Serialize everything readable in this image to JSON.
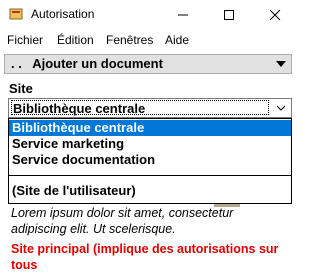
{
  "window": {
    "title": "Autorisation"
  },
  "menu": {
    "items": [
      "Fichier",
      "Édition",
      "Fenêtres",
      "Aide"
    ]
  },
  "toolbar": {
    "label": ". .   Ajouter un document"
  },
  "site": {
    "label": "Site",
    "selected": "Bibliothèque centrale",
    "options": [
      "Bibliothèque centrale",
      "Service marketing",
      "Service documentation",
      "(Site de l'utilisateur)"
    ]
  },
  "description": "Lorem ipsum dolor sit amet, consectetur adipiscing elit. Ut scelerisque.",
  "hint": "Site principal (implique des autorisations sur tous",
  "colors": {
    "selection": "#0078d7",
    "hint": "#e00000"
  }
}
